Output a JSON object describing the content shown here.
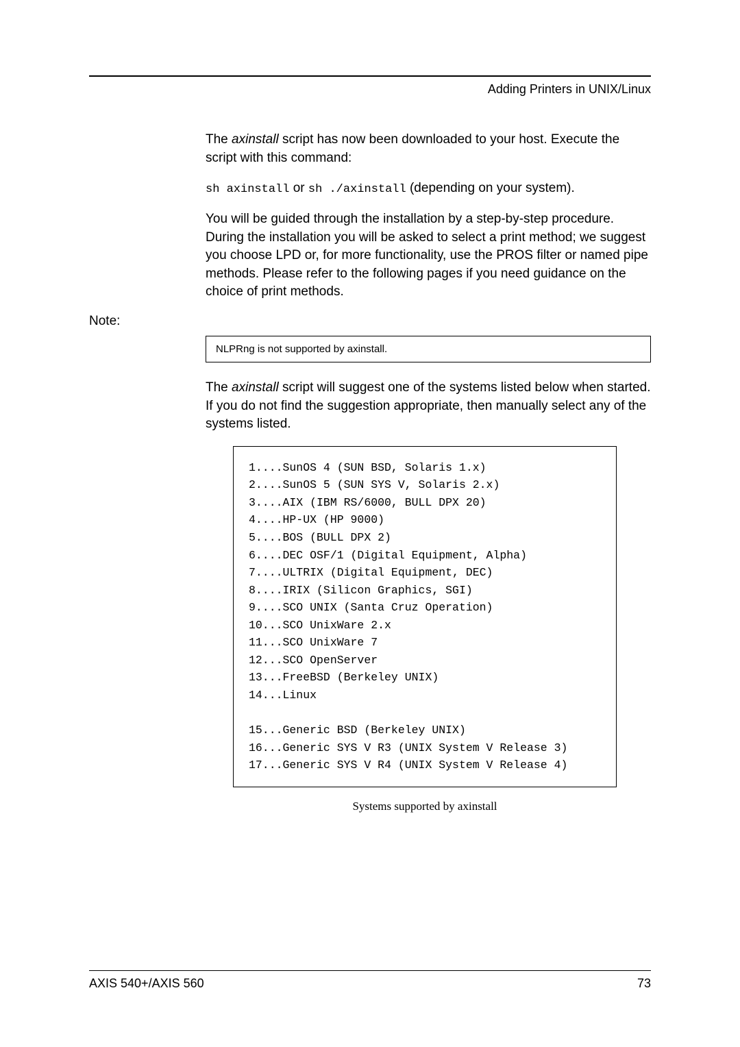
{
  "header": {
    "section_title": "Adding Printers in UNIX/Linux"
  },
  "para1": {
    "pre_italic": "The ",
    "italic": "axinstall",
    "post_italic": " script has now been downloaded to your host. Execute the script with this command:"
  },
  "command_line": {
    "cmd1": "sh axinstall",
    "mid": " or ",
    "cmd2": "sh ./axinstall",
    "tail": " (depending on your system)."
  },
  "para2": "You will be guided through the installation by a step-by-step procedure. During the installation you will be asked to select a print method; we suggest you choose LPD or, for more functionality, use the PROS filter or named pipe methods. Please refer to the following pages if you need guidance on the choice of print methods.",
  "note": {
    "label": "Note:",
    "text": "NLPRng is not supported by axinstall."
  },
  "para3": {
    "pre_italic": "The ",
    "italic": "axinstall",
    "post_italic": " script will suggest one of the systems listed below when started. If you do not find the suggestion appropriate, then manually select any of the systems listed."
  },
  "systems_list": "1....SunOS 4 (SUN BSD, Solaris 1.x)\n2....SunOS 5 (SUN SYS V, Solaris 2.x)\n3....AIX (IBM RS/6000, BULL DPX 20)\n4....HP-UX (HP 9000)\n5....BOS (BULL DPX 2)\n6....DEC OSF/1 (Digital Equipment, Alpha)\n7....ULTRIX (Digital Equipment, DEC)\n8....IRIX (Silicon Graphics, SGI)\n9....SCO UNIX (Santa Cruz Operation)\n10...SCO UnixWare 2.x\n11...SCO UnixWare 7\n12...SCO OpenServer\n13...FreeBSD (Berkeley UNIX)\n14...Linux\n\n15...Generic BSD (Berkeley UNIX)\n16...Generic SYS V R3 (UNIX System V Release 3)\n17...Generic SYS V R4 (UNIX System V Release 4)",
  "caption": "Systems supported by axinstall",
  "footer": {
    "product": "AXIS 540+/AXIS 560",
    "page": "73"
  }
}
